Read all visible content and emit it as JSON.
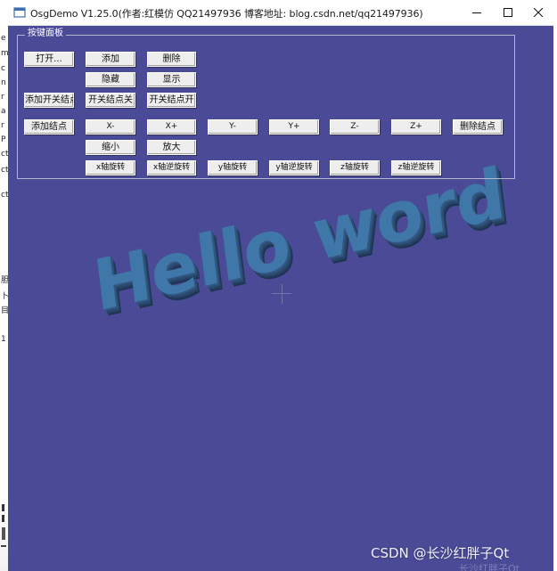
{
  "window": {
    "title": "OsgDemo V1.25.0(作者:红模仿 QQ21497936 博客地址: blog.csdn.net/qq21497936)",
    "minimize_icon": "minimize-icon",
    "maximize_icon": "maximize-icon",
    "close_icon": "close-icon"
  },
  "panel": {
    "title": "按键面板",
    "row1": {
      "open": "打开...",
      "add": "添加",
      "delete": "删除"
    },
    "row2": {
      "hide": "隐藏",
      "show": "显示"
    },
    "row3": {
      "add_switch_node": "添加开关结点",
      "switch_off": "开关结点关",
      "switch_on": "开关结点开"
    },
    "row4": {
      "add_node": "添加结点",
      "x_minus": "X-",
      "x_plus": "X+",
      "y_minus": "Y-",
      "y_plus": "Y+",
      "z_minus": "Z-",
      "z_plus": "Z+",
      "delete_node": "删除结点"
    },
    "row5": {
      "shrink": "缩小",
      "enlarge": "放大"
    },
    "row6": {
      "x_rotate": "x轴旋转",
      "x_rotate_rev": "x轴逆旋转",
      "y_rotate": "y轴旋转",
      "y_rotate_rev": "y轴逆旋转",
      "z_rotate": "z轴旋转",
      "z_rotate_rev": "z轴逆旋转"
    }
  },
  "scene": {
    "text": "Hello word",
    "background": "#4a4a96",
    "text_color": "#3f77a8"
  },
  "watermark": {
    "text": "CSDN @长沙红胖子Qt",
    "faint": "长沙红胖子Qt"
  },
  "behind_window": {
    "chars": [
      "e",
      "m",
      "c",
      "n",
      "r",
      "a",
      "r",
      "P",
      "ct",
      "ct",
      "ct",
      "胆",
      "卜",
      "目",
      "1"
    ]
  }
}
